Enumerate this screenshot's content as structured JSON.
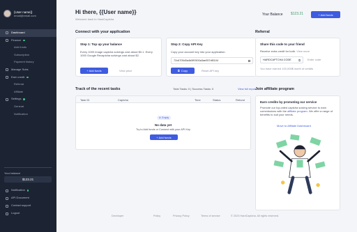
{
  "user": {
    "name": "{User name}}",
    "email": "email@email.com"
  },
  "sidebar": {
    "items": [
      {
        "label": "Dashboard",
        "active": true,
        "type": "main"
      },
      {
        "label": "Finance",
        "type": "main",
        "dot": true
      },
      {
        "label": "Add funds",
        "type": "sub"
      },
      {
        "label": "Subscription",
        "type": "sub"
      },
      {
        "label": "Payment history",
        "type": "sub"
      },
      {
        "label": "Manage Subs",
        "type": "main"
      },
      {
        "label": "Earn credit",
        "type": "main",
        "dot": true
      },
      {
        "label": "Referral",
        "type": "sub"
      },
      {
        "label": "Affiliate",
        "type": "sub"
      },
      {
        "label": "Settings",
        "type": "main",
        "dot": true
      },
      {
        "label": "General",
        "type": "sub"
      },
      {
        "label": "Notification",
        "type": "sub"
      }
    ],
    "balance_label": "Your balance",
    "balance_value": "$123.21",
    "bottom_items": [
      {
        "label": "Notification",
        "dot": true
      },
      {
        "label": "API Document"
      },
      {
        "label": "Contact support"
      },
      {
        "label": "Logout"
      }
    ]
  },
  "header": {
    "greeting": "Hi there, {{User name}}",
    "subtitle": "Welcome back to HardCaptcha",
    "balance_label": "Your Balance",
    "balance_value": "$123.21",
    "add_funds": "+  Add funds"
  },
  "connect": {
    "title": "Connect with your application",
    "step1_title": "Step 1: Top up your balance",
    "step1_text": "Every 1000 image captcha solvings cost about $0.1. Every 1000 Google Recaptcha solvings cost about $2.",
    "step1_btn": "+  Add funds",
    "step1_link": "View price",
    "step2_title": "Step 2: Copy API Key",
    "step2_text": "Copy your account key into your application:",
    "api_key": "72c6705d3a4b0ff1500a3ae057df0104",
    "copy_btn": "Copy",
    "reset_link": "Reset API key"
  },
  "referral": {
    "title": "Referral",
    "card_title": "Share this code to your friend",
    "card_text": "Receive extra credit for both.",
    "view_more": "View more",
    "code": "HARDCAPTCHA CODE",
    "enter_code": "Enter code",
    "earned": "You have earned 100,000$ worth of credits"
  },
  "tasks": {
    "title": "Track of the recent tasks",
    "summary": "Total Tasks: 0 | Success Tasks: 0",
    "view_report": "View full report",
    "columns": [
      "Task ID",
      "Captcha",
      "Time",
      "Status",
      "Refund"
    ],
    "badge": "Empty",
    "empty_title": "No data yet",
    "empty_text": "Try to Add funds or Connect with your API Key",
    "add_funds": "+  Add funds"
  },
  "affiliate": {
    "title": "Join affiliate program",
    "card_title": "Earn credits by promoting our service",
    "text_before": "Promote our top-rated captcha solving service to earn commissions with the",
    "link": "affiliate program",
    "text_after": ". We offer a range of benefits to suit your needs.",
    "move_link": "Move to Affiliate Dashboard"
  },
  "footer": {
    "links": [
      "Developer",
      "Policy",
      "Privacy Policy",
      "Terms of service"
    ],
    "copyright": "2023 HardCaptcha. All rights reserved."
  },
  "colors": {
    "accent": "#3f5ce0",
    "sidebar": "#1c2434",
    "positive": "#3e9b6b"
  }
}
